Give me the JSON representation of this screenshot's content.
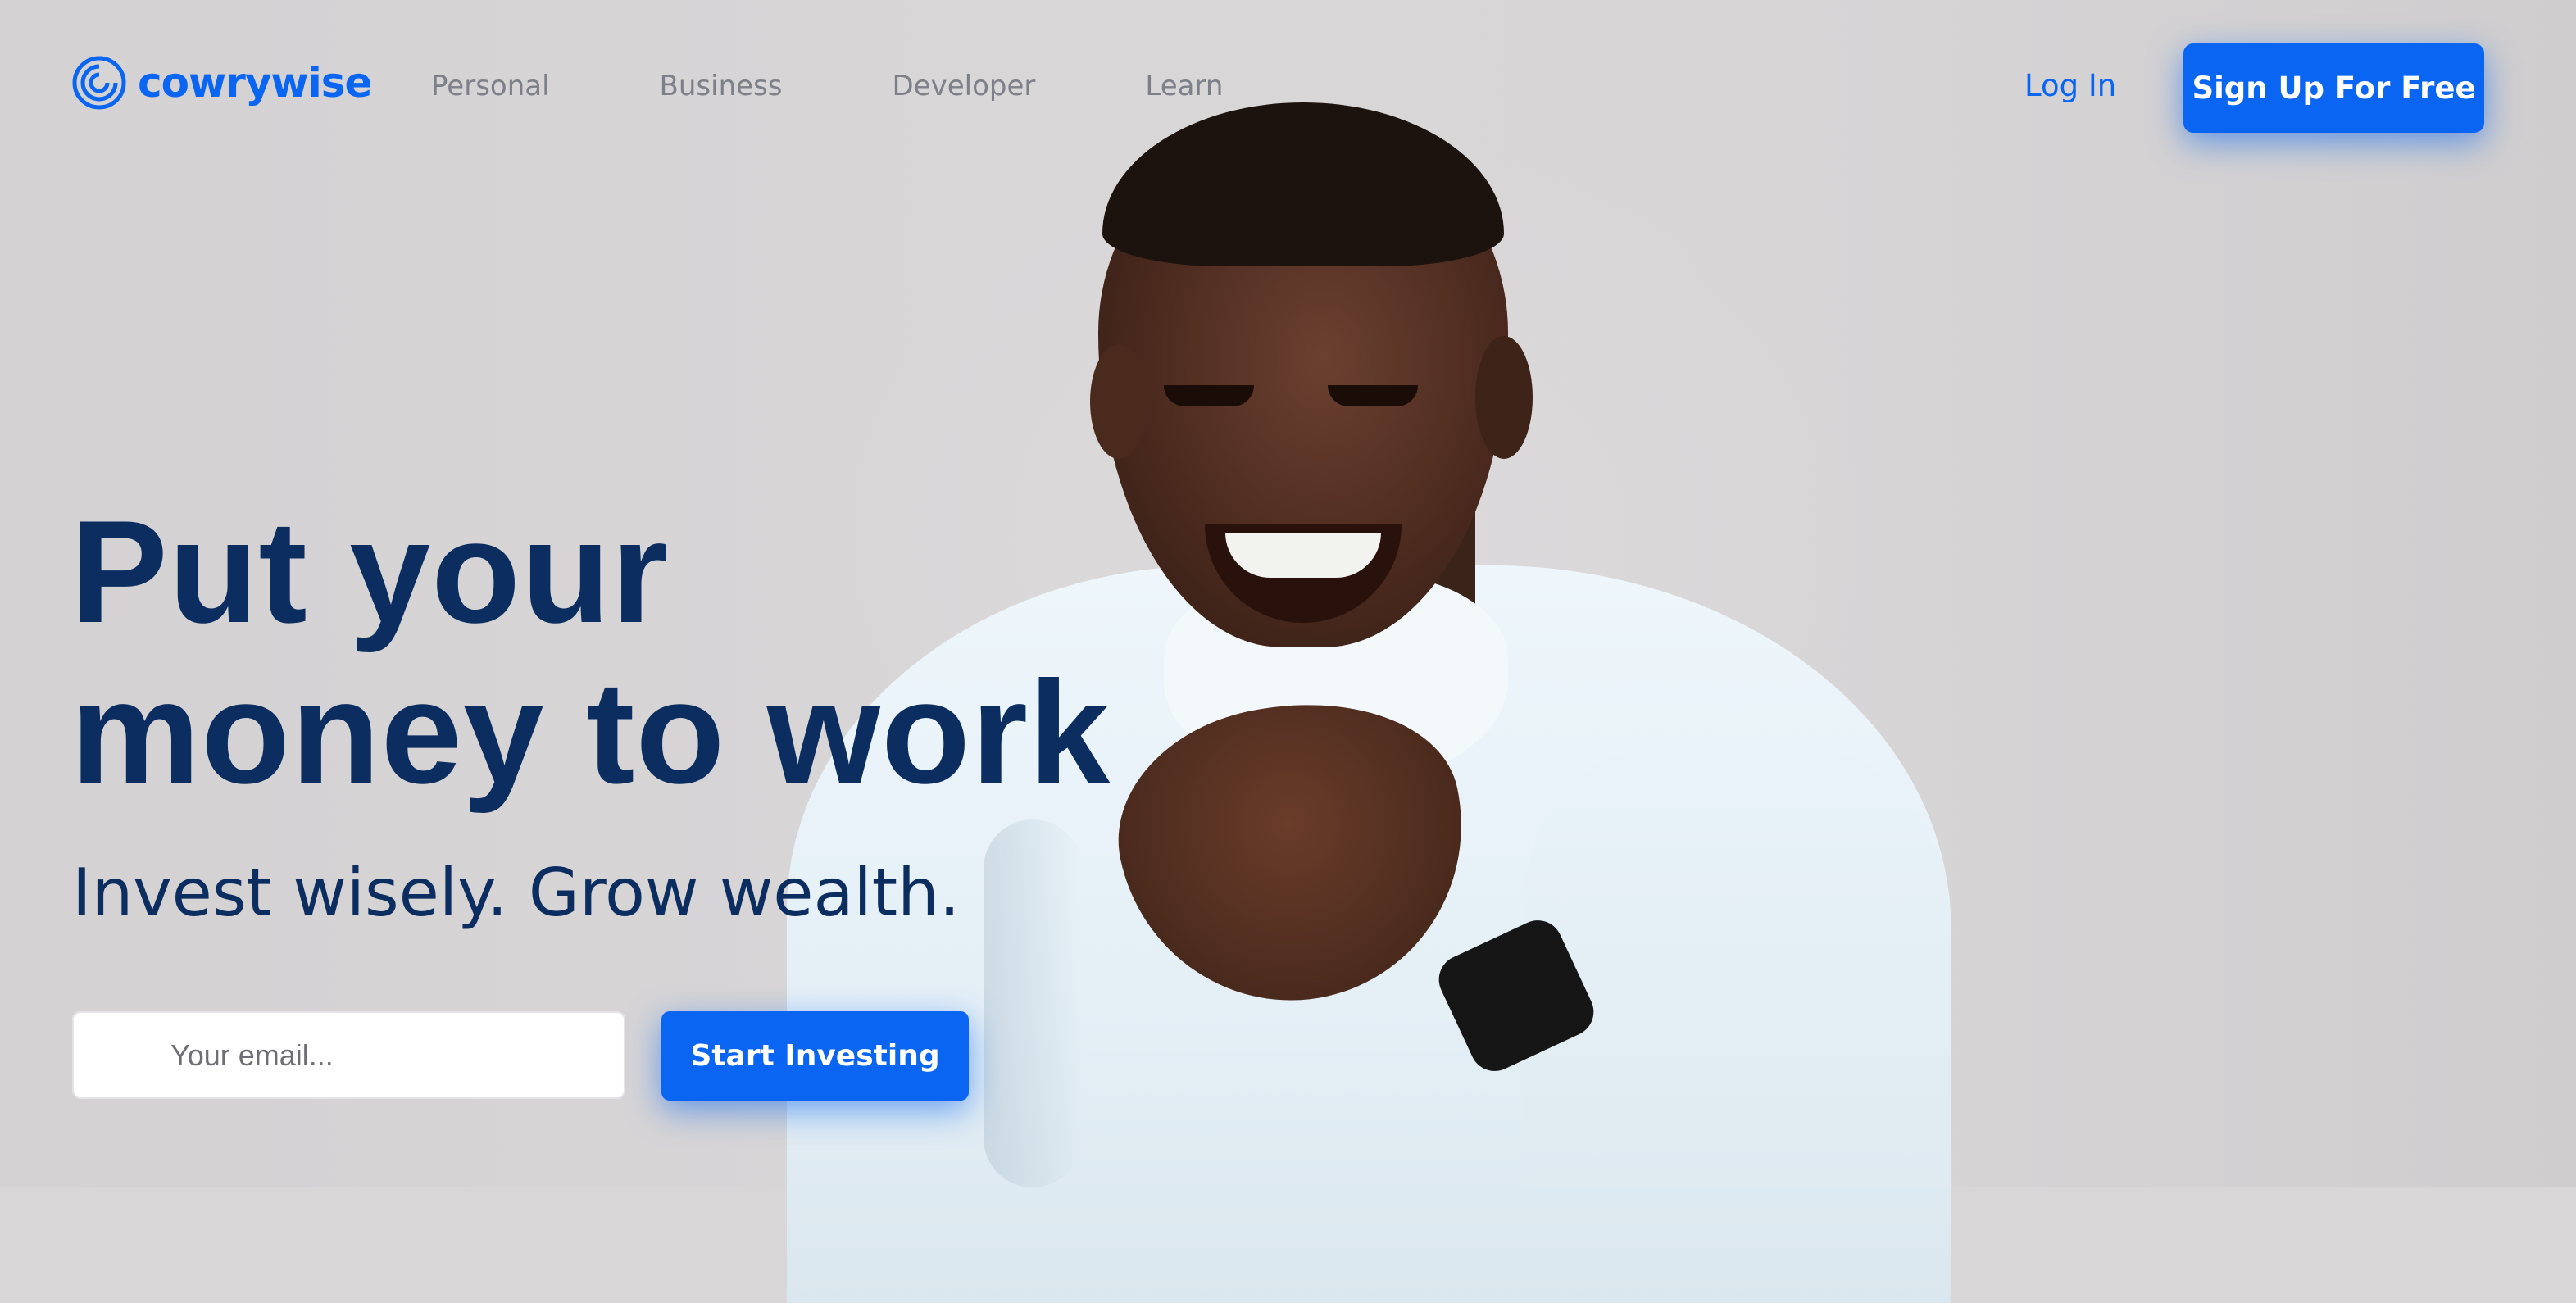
{
  "brand": {
    "name": "cowrywise",
    "icon": "cowrywise-spiral-logo-icon",
    "color": "#0a66f2"
  },
  "nav": {
    "links": [
      "Personal",
      "Business",
      "Developer",
      "Learn"
    ],
    "login_label": "Log In",
    "signup_label": "Sign Up For Free"
  },
  "hero": {
    "headline_line1": "Put your",
    "headline_line2": "money to work",
    "subheadline": "Invest wisely. Grow wealth.",
    "email_placeholder": "Your email...",
    "cta_label": "Start Investing",
    "text_color": "#0b2d5f"
  }
}
